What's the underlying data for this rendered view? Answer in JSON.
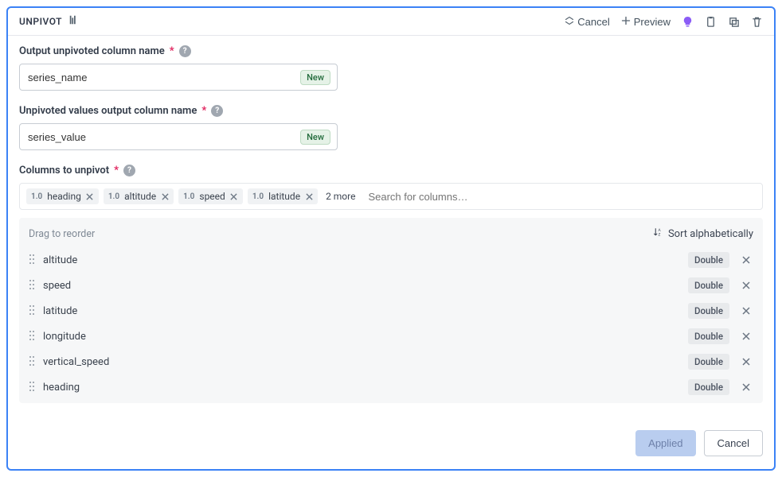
{
  "header": {
    "title": "UNPIVOT",
    "cancel_label": "Cancel",
    "preview_label": "Preview"
  },
  "fields": {
    "output_name": {
      "label": "Output unpivoted column name",
      "value": "series_name",
      "badge": "New"
    },
    "values_name": {
      "label": "Unpivoted values output column name",
      "value": "series_value",
      "badge": "New"
    },
    "columns": {
      "label": "Columns to unpivot",
      "tags": [
        {
          "type": "1.0",
          "name": "heading"
        },
        {
          "type": "1.0",
          "name": "altitude"
        },
        {
          "type": "1.0",
          "name": "speed"
        },
        {
          "type": "1.0",
          "name": "latitude"
        }
      ],
      "more": "2 more",
      "placeholder": "Search for columns…"
    }
  },
  "reorder": {
    "hint": "Drag to reorder",
    "sort_label": "Sort alphabetically",
    "rows": [
      {
        "name": "altitude",
        "type": "Double"
      },
      {
        "name": "speed",
        "type": "Double"
      },
      {
        "name": "latitude",
        "type": "Double"
      },
      {
        "name": "longitude",
        "type": "Double"
      },
      {
        "name": "vertical_speed",
        "type": "Double"
      },
      {
        "name": "heading",
        "type": "Double"
      }
    ]
  },
  "footer": {
    "applied": "Applied",
    "cancel": "Cancel"
  }
}
